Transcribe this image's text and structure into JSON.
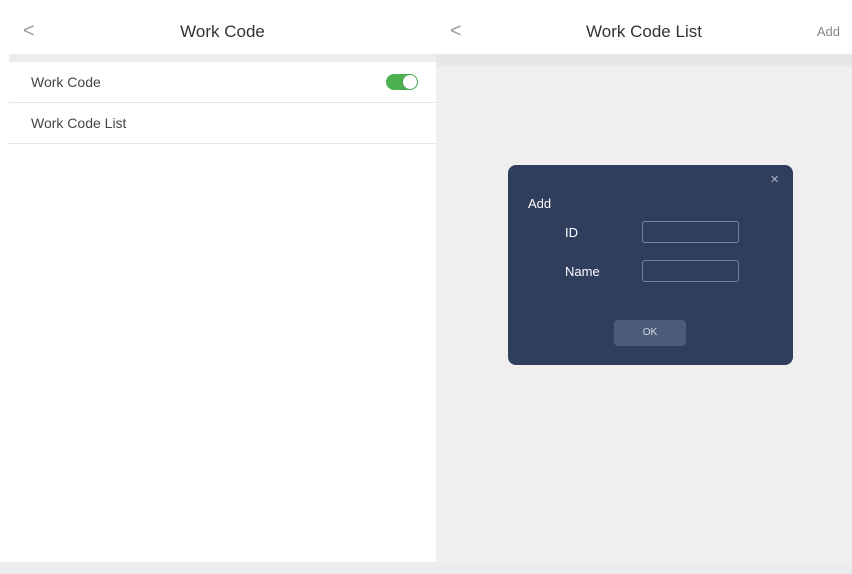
{
  "colors": {
    "toggle_on": "#4caf50",
    "dialog_bg": "#2f3e5d",
    "right_panel_bg": "#efefef"
  },
  "left_panel": {
    "back_glyph": "<",
    "title": "Work Code",
    "rows": [
      {
        "label": "Work Code",
        "toggle_on": true
      },
      {
        "label": "Work Code List"
      }
    ]
  },
  "right_panel": {
    "back_glyph": "<",
    "title": "Work Code List",
    "add_label": "Add"
  },
  "dialog": {
    "close_glyph": "×",
    "title": "Add",
    "id_label": "ID",
    "id_value": "",
    "name_label": "Name",
    "name_value": "",
    "ok_label": "OK"
  }
}
